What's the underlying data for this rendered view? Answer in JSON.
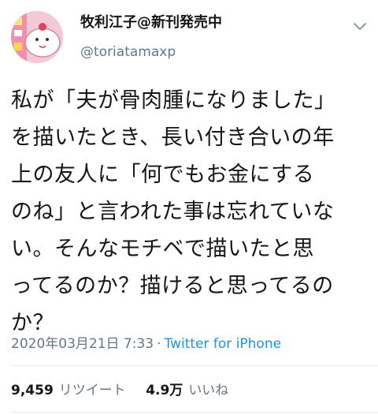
{
  "author": {
    "display_name": "牧利江子@新刊発売中",
    "handle": "@toriatamaxp"
  },
  "icons": {
    "avatar": "cartoon-character-avatar",
    "caret": "chevron-down-icon"
  },
  "tweet": {
    "text": "私が「夫が骨肉腫になりました」\nを描いたとき、長い付き合いの年\n上の友人に「何でもお金にする\nのね」と言われた事は忘れていな\nい。そんなモチベで描いたと思\nってるのか？描けると思ってるの\nか？",
    "timestamp": "2020年03月21日 7:33",
    "separator": "·",
    "source": "Twitter for iPhone"
  },
  "stats": {
    "retweets_count": "9,459",
    "retweets_label": "リツイート",
    "likes_count": "4.9万",
    "likes_label": "いいね"
  },
  "colors": {
    "text": "#14171a",
    "secondary": "#657786",
    "link": "#1b95e0",
    "divider": "#e6ecf0"
  }
}
